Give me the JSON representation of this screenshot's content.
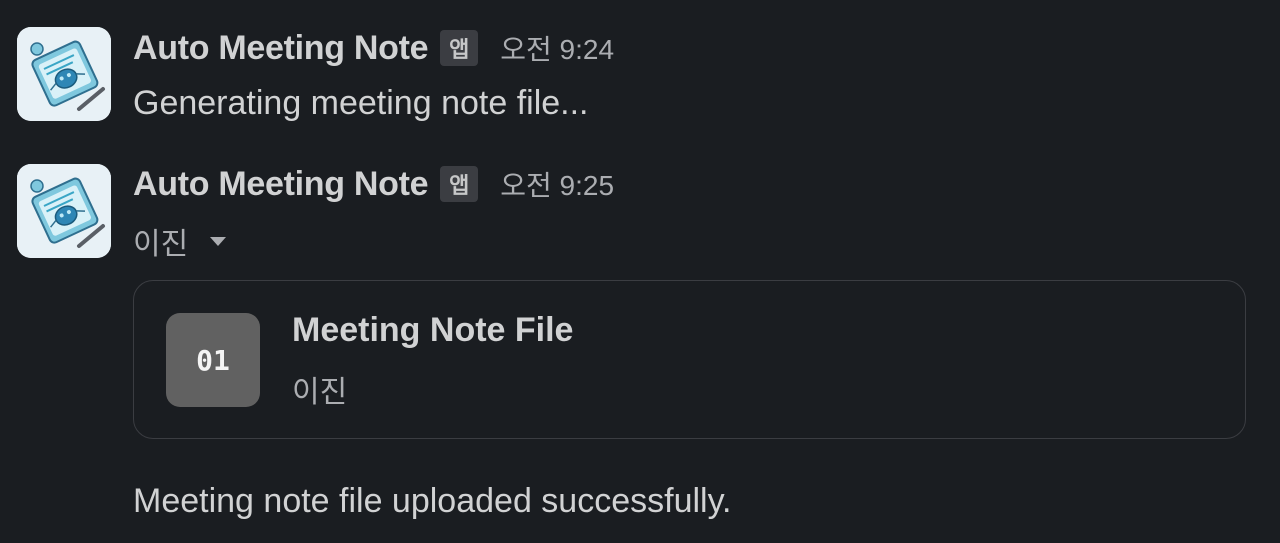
{
  "messages": [
    {
      "sender": "Auto Meeting Note",
      "badge": "앱",
      "time": "오전 9:24",
      "text": "Generating meeting note file..."
    },
    {
      "sender": "Auto Meeting Note",
      "badge": "앱",
      "time": "오전 9:25",
      "sub_author": "이진",
      "file": {
        "icon_label": "01",
        "title": "Meeting Note File",
        "subtitle": "이진"
      },
      "text": "Meeting note file uploaded successfully."
    }
  ],
  "colors": {
    "background": "#1a1d21",
    "text_primary": "#d1d2d3",
    "text_secondary": "#abadb1",
    "badge_bg": "#3b3d42",
    "file_icon_bg": "#616161",
    "card_border": "#3b3d42"
  }
}
